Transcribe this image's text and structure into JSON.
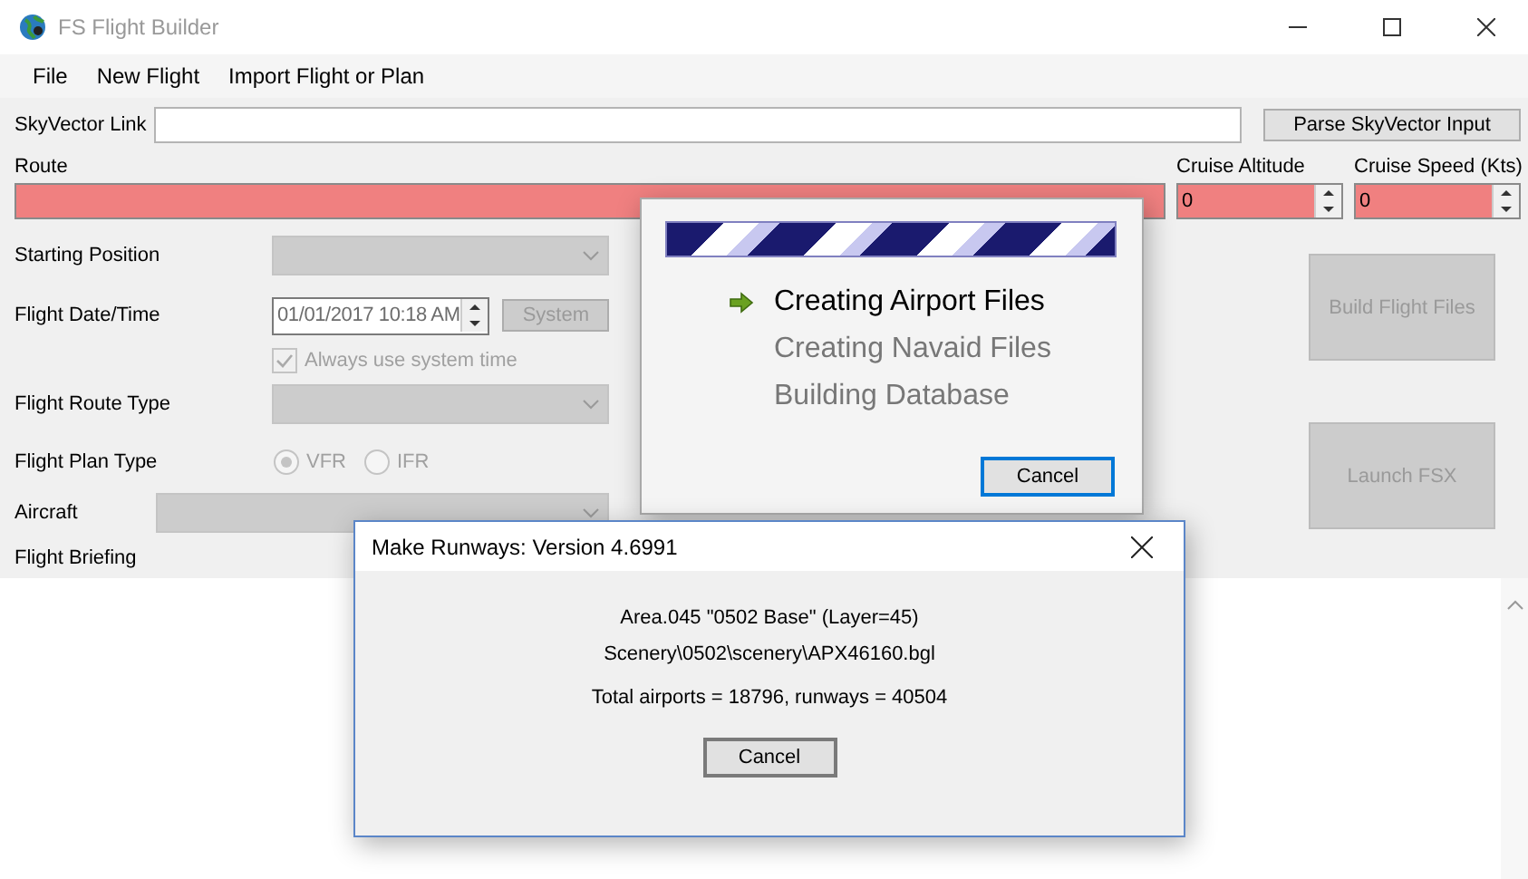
{
  "window": {
    "title": "FS Flight Builder"
  },
  "menu": [
    "File",
    "New Flight",
    "Import Flight or Plan"
  ],
  "skyvector": {
    "label": "SkyVector Link",
    "button": "Parse SkyVector Input"
  },
  "route": {
    "label": "Route",
    "invalid": true
  },
  "cruise": [
    {
      "label": "Cruise Altitude",
      "value": "0",
      "invalid": true
    },
    {
      "label": "Cruise Speed (Kts)",
      "value": "0",
      "invalid": true
    }
  ],
  "form": [
    {
      "kind": "combo",
      "label": "Starting Position",
      "disabled": true
    },
    {
      "kind": "datetime",
      "label": "Flight Date/Time",
      "value": "01/01/2017 10:18 AM",
      "button": "System",
      "disabled": true
    },
    {
      "kind": "check",
      "label": "Always use system time",
      "checked": true,
      "disabled": true
    },
    {
      "kind": "combo",
      "label": "Flight Route Type",
      "disabled": true
    },
    {
      "kind": "radio",
      "label": "Flight Plan Type",
      "disabled": true,
      "options": [
        {
          "label": "VFR",
          "selected": true
        },
        {
          "label": "IFR",
          "selected": false
        }
      ]
    },
    {
      "kind": "wide",
      "label": "Aircraft",
      "disabled": true
    },
    {
      "kind": "caption",
      "label": "Flight Briefing"
    }
  ],
  "actions": [
    {
      "label": "Build Flight Files",
      "disabled": true
    },
    {
      "label": "Launch FSX",
      "disabled": true
    }
  ],
  "progress_dialog": {
    "level": 1,
    "steps": [
      {
        "label": "Creating Airport Files",
        "active": true
      },
      {
        "label": "Creating Navaid Files",
        "active": false
      },
      {
        "label": "Building Database",
        "active": false
      }
    ],
    "button": "Cancel"
  },
  "runways_dialog": {
    "title": "Make Runways: Version 4.6991",
    "lines": [
      "Area.045 \"0502 Base\" (Layer=45)",
      "Scenery\\0502\\scenery\\APX46160.bgl",
      "Total airports = 18796, runways = 40504"
    ],
    "button": "Cancel"
  }
}
